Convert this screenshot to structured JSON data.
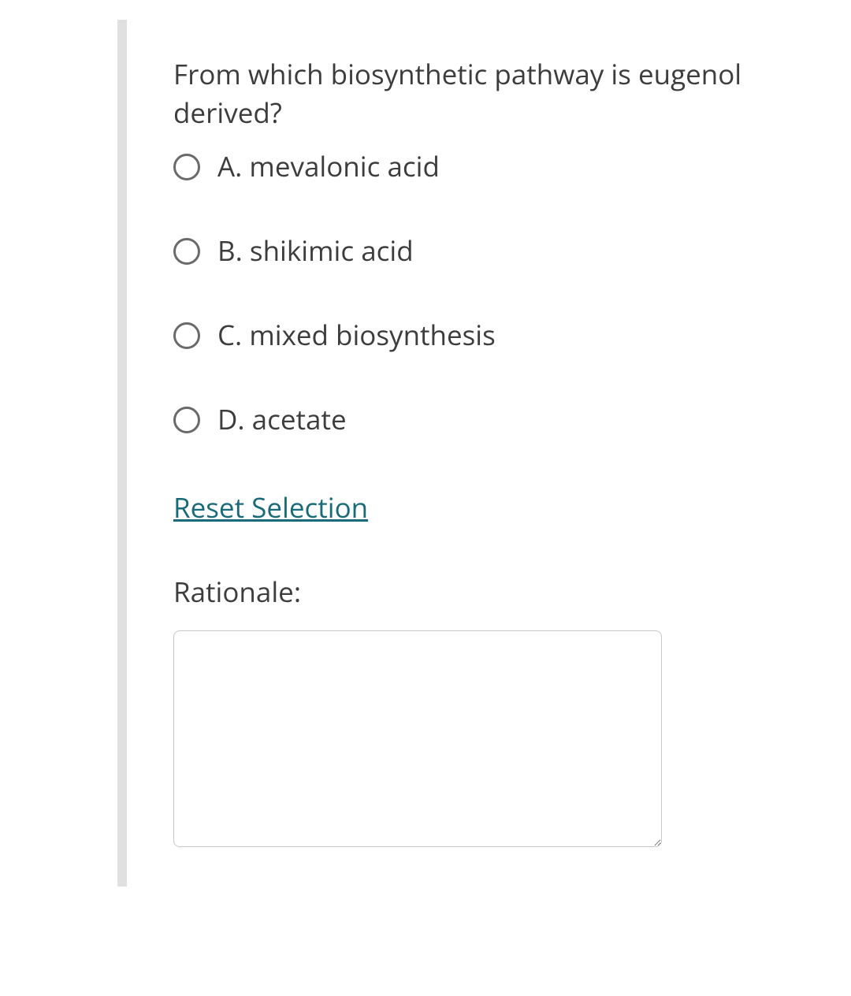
{
  "question": {
    "text": "From which biosynthetic pathway is eugenol derived?",
    "options": {
      "a": "A. mevalonic acid",
      "b": "B. shikimic acid",
      "c": "C. mixed biosynthesis",
      "d": "D. acetate"
    },
    "reset_label": "Reset Selection",
    "rationale_label": "Rationale:",
    "rationale_value": ""
  }
}
